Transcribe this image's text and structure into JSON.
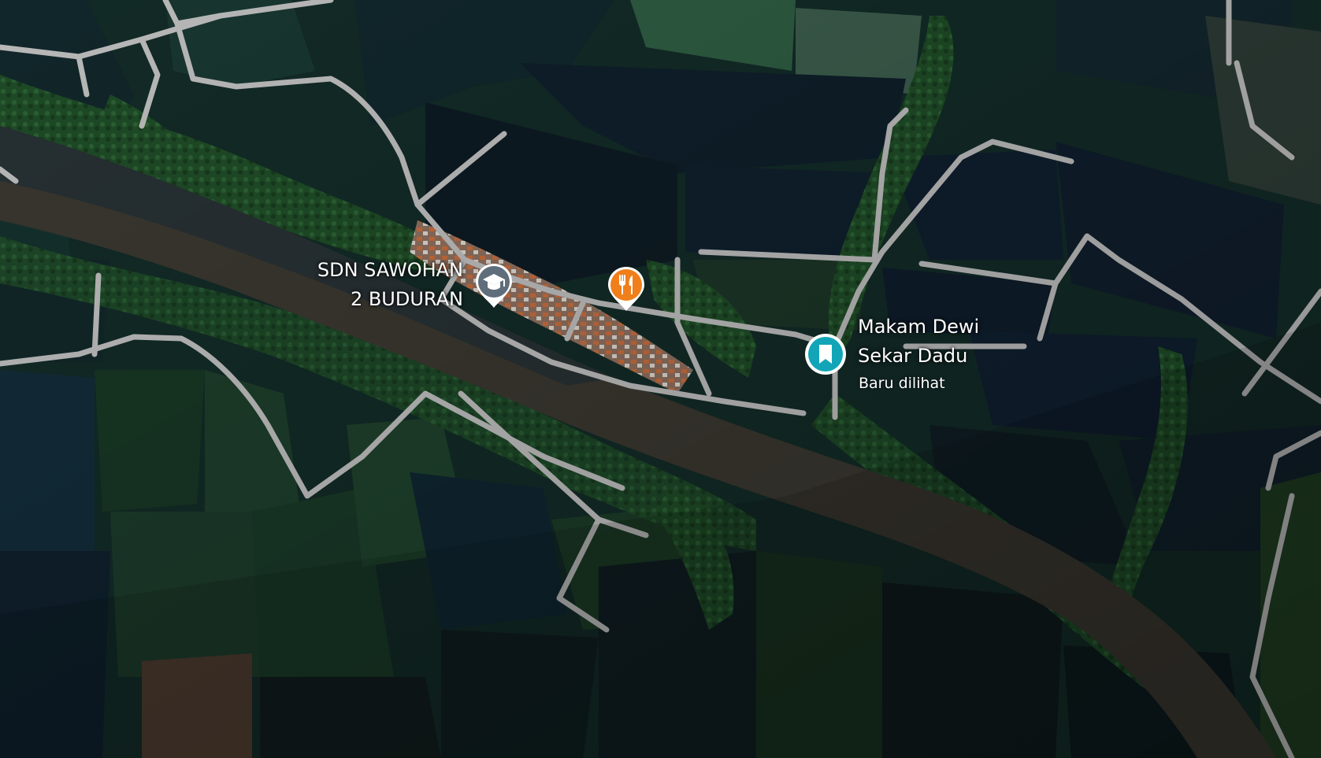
{
  "map": {
    "type": "satellite",
    "water_color": "#3a3a33",
    "road_color": "#b9b9b9",
    "field_dark": "#0f1c22",
    "vegetation": "#1d3d22"
  },
  "pois": {
    "school": {
      "name_line1": "SDN SAWOHAN",
      "name_line2": "2 BUDURAN",
      "icon": "graduation-cap-icon",
      "color": "#5f6e7a"
    },
    "restaurant": {
      "icon": "fork-knife-icon",
      "color": "#f07f1b"
    },
    "saved_place": {
      "name_line1": "Makam Dewi",
      "name_line2": "Sekar Dadu",
      "subtitle": "Baru dilihat",
      "icon": "bookmark-icon",
      "color": "#12a5b8"
    }
  }
}
